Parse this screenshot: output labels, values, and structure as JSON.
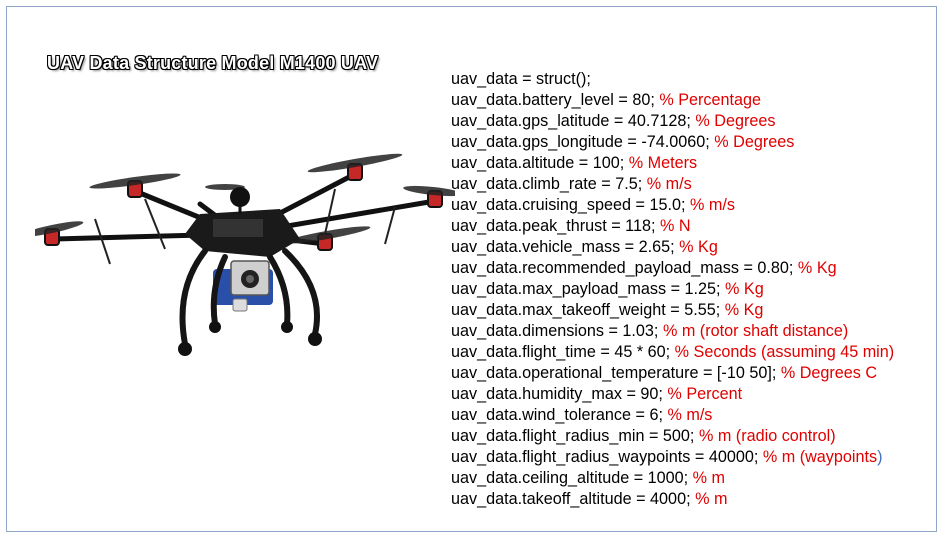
{
  "title": "UAV Data Structure Model M1400 UAV",
  "colors": {
    "comment": "#e00000",
    "code": "#000000",
    "accent_paren": "#4472c4",
    "border": "#8ea5c8"
  },
  "drone_image": "quadcopter-octocopter-photo",
  "code_lines": [
    {
      "code": "uav_data = struct();",
      "comment": "",
      "tail": ""
    },
    {
      "code": "uav_data.battery_level = 80; ",
      "comment": "% Percentage",
      "tail": ""
    },
    {
      "code": "uav_data.gps_latitude = 40.7128; ",
      "comment": "% Degrees",
      "tail": ""
    },
    {
      "code": "uav_data.gps_longitude = -74.0060; ",
      "comment": "% Degrees",
      "tail": ""
    },
    {
      "code": "uav_data.altitude = 100; ",
      "comment": "% Meters",
      "tail": ""
    },
    {
      "code": "uav_data.climb_rate = 7.5; ",
      "comment": "% m/s",
      "tail": ""
    },
    {
      "code": "uav_data.cruising_speed = 15.0; ",
      "comment": "% m/s",
      "tail": ""
    },
    {
      "code": "uav_data.peak_thrust = 118; ",
      "comment": "% N",
      "tail": ""
    },
    {
      "code": "uav_data.vehicle_mass = 2.65; ",
      "comment": "% Kg",
      "tail": ""
    },
    {
      "code": "uav_data.recommended_payload_mass = 0.80; ",
      "comment": "% Kg",
      "tail": ""
    },
    {
      "code": "uav_data.max_payload_mass = 1.25; ",
      "comment": "% Kg",
      "tail": ""
    },
    {
      "code": "uav_data.max_takeoff_weight = 5.55; ",
      "comment": "% Kg",
      "tail": ""
    },
    {
      "code": "uav_data.dimensions = 1.03; ",
      "comment": "% m (rotor shaft distance)",
      "tail": ""
    },
    {
      "code": "uav_data.flight_time = 45 * 60; ",
      "comment": "% Seconds (assuming 45 min)",
      "tail": ""
    },
    {
      "code": "uav_data.operational_temperature = [-10 50]; ",
      "comment": "% Degrees C",
      "tail": ""
    },
    {
      "code": "uav_data.humidity_max = 90; ",
      "comment": "% Percent",
      "tail": ""
    },
    {
      "code": "uav_data.wind_tolerance = 6; ",
      "comment": "% m/s",
      "tail": ""
    },
    {
      "code": "uav_data.flight_radius_min = 500; ",
      "comment": "% m (radio control)",
      "tail": ""
    },
    {
      "code": "uav_data.flight_radius_waypoints = 40000; ",
      "comment": "% m (waypoints",
      "tail": ")"
    },
    {
      "code": "uav_data.ceiling_altitude = 1000; ",
      "comment": "% m",
      "tail": ""
    },
    {
      "code": "uav_data.takeoff_altitude = 4000; ",
      "comment": "% m",
      "tail": ""
    }
  ]
}
